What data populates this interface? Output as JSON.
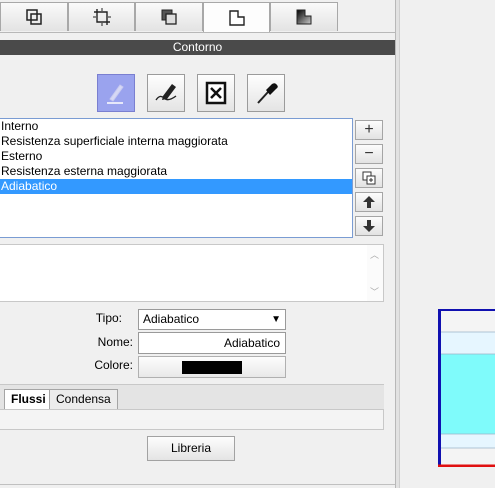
{
  "top_tabs": [
    {
      "icon": "square-overlap-icon"
    },
    {
      "icon": "crop-move-icon"
    },
    {
      "icon": "layer-shape-icon"
    },
    {
      "icon": "contour-shape-icon",
      "active": true
    },
    {
      "icon": "gradient-shape-icon"
    }
  ],
  "header": {
    "title": "Contorno"
  },
  "toolbar": {
    "buttons": [
      {
        "icon": "pencil-icon",
        "active": true
      },
      {
        "icon": "edit-line-icon"
      },
      {
        "icon": "delete-box-icon"
      },
      {
        "icon": "eyedropper-icon"
      }
    ]
  },
  "boundary_list": {
    "items": [
      "Interno",
      "Resistenza superficiale interna maggiorata",
      "Esterno",
      "Resistenza esterna maggiorata",
      "Adiabatico"
    ],
    "selected": "Adiabatico"
  },
  "side_buttons": {
    "add": "+",
    "remove": "−",
    "copy_icon": "duplicate-icon",
    "up_icon": "arrow-up-icon",
    "down_icon": "arrow-down-icon"
  },
  "form": {
    "tipo_label": "Tipo:",
    "tipo_value": "Adiabatico",
    "nome_label": "Nome:",
    "nome_value": "Adiabatico",
    "colore_label": "Colore:",
    "colore_value": "#000000"
  },
  "bottom_tabs": {
    "flussi": "Flussi",
    "condensa": "Condensa"
  },
  "library_button": "Libreria",
  "colors": {
    "header_bg": "#4a4a4a",
    "selection": "#3399ff",
    "active_tool": "#9aa3ee",
    "drawing_fill": "#7ffbfb",
    "drawing_border_left": "#1010b0",
    "drawing_border_bottom": "#e01010"
  }
}
